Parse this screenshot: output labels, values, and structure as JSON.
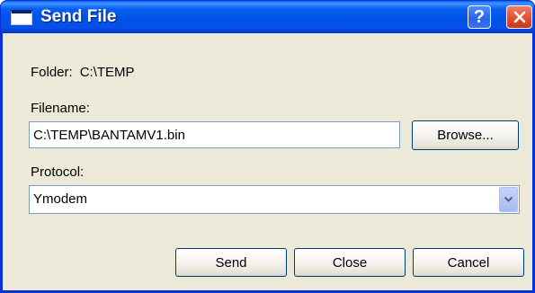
{
  "window": {
    "title": "Send File",
    "help_label": "?",
    "close_label": "✕"
  },
  "folder": {
    "label": "Folder:",
    "value": "C:\\TEMP"
  },
  "filename": {
    "label": "Filename:",
    "value": "C:\\TEMP\\BANTAMV1.bin",
    "browse_label": "Browse..."
  },
  "protocol": {
    "label": "Protocol:",
    "selected": "Ymodem",
    "dropdown_icon": "chevron-down-icon"
  },
  "buttons": {
    "send": "Send",
    "close": "Close",
    "cancel": "Cancel"
  },
  "colors": {
    "titlebar": "#0a5ff0",
    "dialog_background": "#ece9d8",
    "close_button": "#e04a2a"
  }
}
